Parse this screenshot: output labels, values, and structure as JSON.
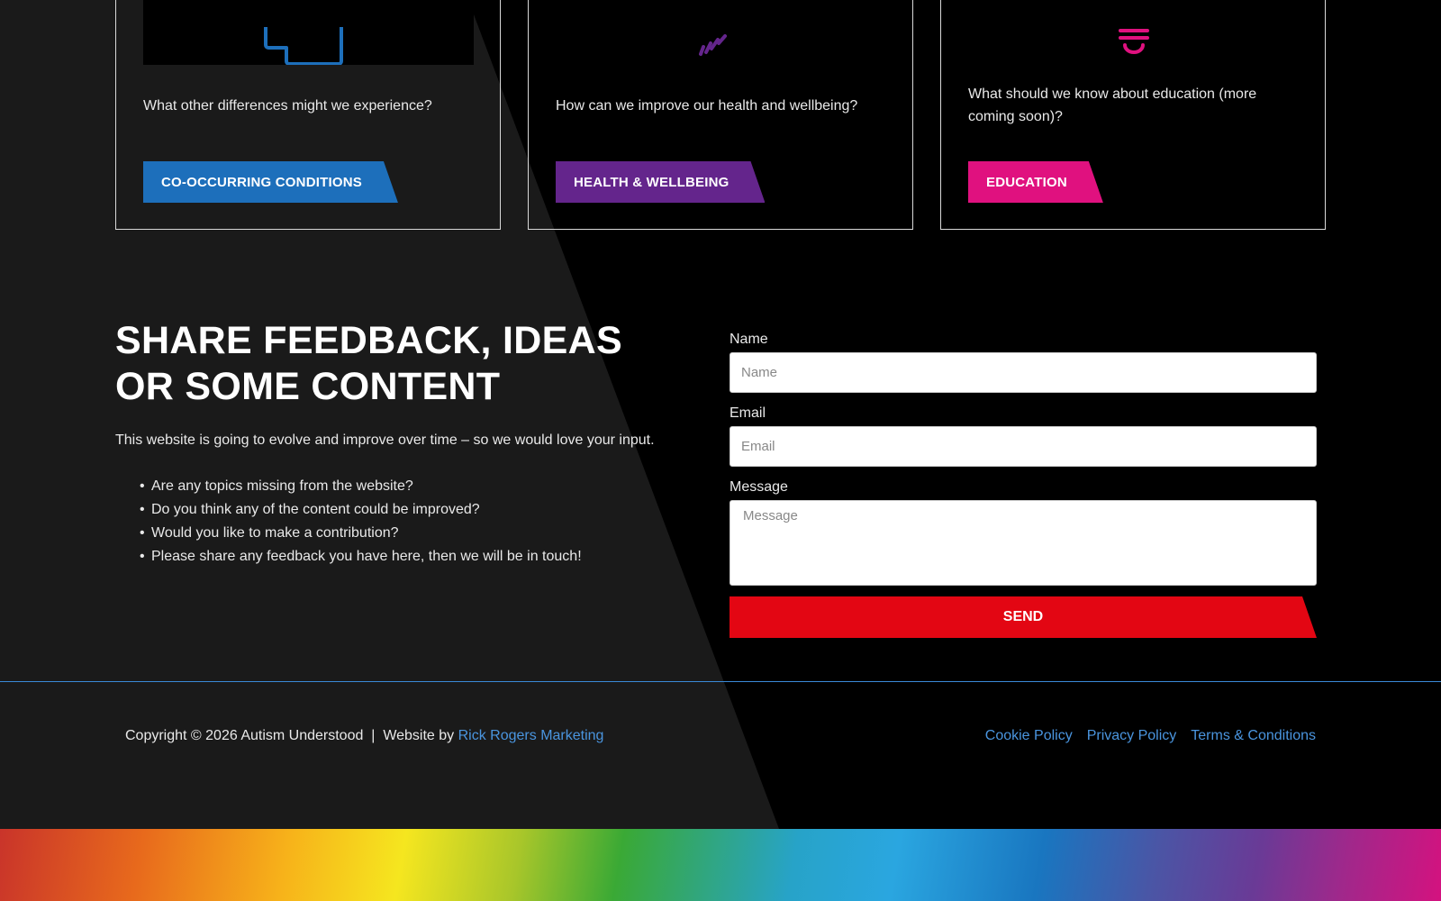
{
  "cards": [
    {
      "icon": "puzzle-piece-icon",
      "question": "What other differences might we experience?",
      "button_label": "CO-OCCURRING CONDITIONS",
      "color": "#1d6fbb"
    },
    {
      "icon": "heart-pulse-icon",
      "question": "How can we improve our health and wellbeing?",
      "button_label": "HEALTH & WELLBEING",
      "color": "#64258c"
    },
    {
      "icon": "lightbulb-icon",
      "question": "What should we know about education (more coming soon)?",
      "button_label": "EDUCATION",
      "color": "#e0117f"
    }
  ],
  "feedback": {
    "title": "SHARE FEEDBACK, IDEAS OR SOME CONTENT",
    "intro": "This website is going to evolve and improve over time – so we would love your input.",
    "bullets": [
      "Are any topics missing from the website?",
      "Do you think any of the content could be improved?",
      "Would you like to make a contribution?",
      "Please share any feedback you have here, then we will be in touch!"
    ]
  },
  "form": {
    "name_label": "Name",
    "name_placeholder": "Name",
    "email_label": "Email",
    "email_placeholder": "Email",
    "message_label": "Message",
    "message_placeholder": "Message",
    "send_label": "SEND",
    "send_color": "#e30613"
  },
  "footer": {
    "copyright": "Copyright © 2026 Autism Understood  |  Website by ",
    "credit_link": "Rick Rogers Marketing",
    "links": [
      "Cookie Policy",
      "Privacy Policy",
      "Terms & Conditions"
    ],
    "link_color": "#4a95df",
    "divider_color": "#3a8ad8"
  }
}
